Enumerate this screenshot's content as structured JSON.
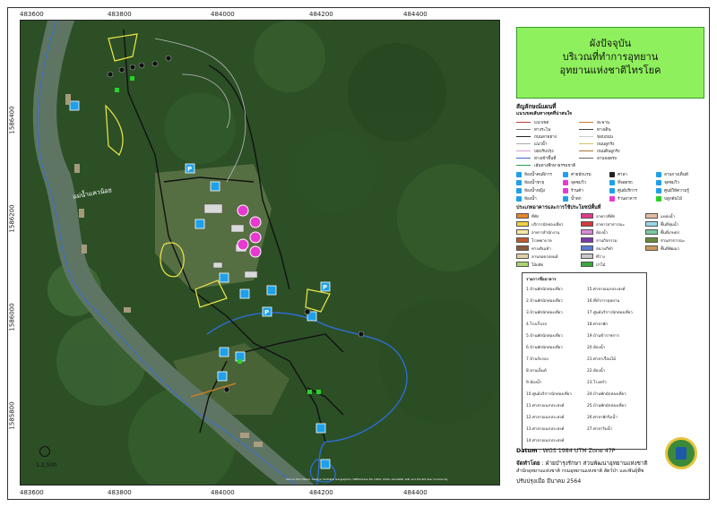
{
  "title": {
    "line1": "ผังปัจจุบัน",
    "line2": "บริเวณที่ทำการอุทยาน",
    "line3": "อุทยานแห่งชาติไทรโยค"
  },
  "grid": {
    "x_ticks": [
      "483600",
      "483800",
      "484000",
      "484200",
      "484400"
    ],
    "y_ticks": [
      "1586400",
      "1586200",
      "1586000",
      "1585800"
    ]
  },
  "legend": {
    "heading": "สัญลักษณ์แผนที่",
    "subheading": "แนวเขตเส้นทางจุดที่น่าสนใจ",
    "lines": [
      {
        "label": "แนวเขต",
        "color": "#c23a3a"
      },
      {
        "label": "ทางระไน",
        "color": "#777777"
      },
      {
        "label": "ถนนลาดยาง",
        "color": "#222222"
      },
      {
        "label": "แนวน้ำ",
        "color": "#aaaaaa"
      },
      {
        "label": "บ่อปรับปรุง",
        "color": "#d4a0d4"
      },
      {
        "label": "ทางเข้าพื้นที่",
        "color": "#3a68c8"
      },
      {
        "label": "เส้นทางศึกษาธรรมชาติ",
        "color": "#2d9e4b"
      },
      {
        "label": "สะพาน",
        "color": "#c77d2a"
      },
      {
        "label": "ทางเดิน",
        "color": "#444444"
      },
      {
        "label": "ขอบถนน",
        "color": "#cccccc"
      },
      {
        "label": "ถนนลูกรัง",
        "color": "#d8c060"
      },
      {
        "label": "ถนนดินลูกรัง",
        "color": "#aa7733"
      },
      {
        "label": "ลานจอดรถ",
        "color": "#666666"
      }
    ],
    "points": [
      {
        "label": "ห้องน้ำคนพิการ",
        "icon": "wheelchair-icon"
      },
      {
        "label": "ห้องน้ำชาย",
        "icon": "male-icon"
      },
      {
        "label": "ห้องน้ำหญิง",
        "icon": "female-icon"
      },
      {
        "label": "ห้องน้ำ",
        "icon": "restroom-icon"
      },
      {
        "label": "ค่ายพักแรม",
        "icon": "camp-icon"
      },
      {
        "label": "จุดชมวิว",
        "icon": "view-icon"
      },
      {
        "label": "ร้านค้า",
        "icon": "shop-icon"
      },
      {
        "label": "น้ำตก",
        "icon": "waterfall-icon"
      },
      {
        "label": "ศาลา",
        "icon": "pavilion-icon"
      },
      {
        "label": "ที่จอดรถ",
        "icon": "parking-icon"
      },
      {
        "label": "ศูนย์บริการ",
        "icon": "info-icon"
      },
      {
        "label": "ร้านอาหาร",
        "icon": "food-icon"
      },
      {
        "label": "ลานกางเต็นท์",
        "icon": "tent-icon"
      },
      {
        "label": "จุดชมวิว",
        "icon": "binocular-icon"
      },
      {
        "label": "ศูนย์ให้ความรู้",
        "icon": "education-icon"
      },
      {
        "label": "ปลูกต้นไม้",
        "icon": "tree-icon"
      }
    ],
    "landuse_heading": "ประเภทอาคารและการใช้ประโยชน์พื้นที่",
    "landuse": [
      {
        "label": "ที่พัก",
        "color": "#e8862a"
      },
      {
        "label": "บริการนักท่องเที่ยว",
        "color": "#f2d23c"
      },
      {
        "label": "อาคารสำนักงาน",
        "color": "#f5e6a6"
      },
      {
        "label": "โรงพยาบาล",
        "color": "#c05a2e"
      },
      {
        "label": "ทางเดินเท้า",
        "color": "#8a5a3a"
      },
      {
        "label": "ลานจอดรถยนต์",
        "color": "#e3cfa7"
      },
      {
        "label": "ไม้ผลัด",
        "color": "#a8d46a"
      },
      {
        "label": "อาคารที่พัก",
        "color": "#e23a8a"
      },
      {
        "label": "อาคารสาธารณะ",
        "color": "#d43a3a"
      },
      {
        "label": "ห้องน้ำ",
        "color": "#d78ad7"
      },
      {
        "label": "ลานกิจกรรม",
        "color": "#7a3aa8"
      },
      {
        "label": "สนามกีฬา",
        "color": "#5a7ad8"
      },
      {
        "label": "ที่ว่าง",
        "color": "#c8c8c8"
      },
      {
        "label": "ป่าไม้",
        "color": "#3aa83a"
      },
      {
        "label": "แหล่งน้ำ",
        "color": "#e2bca0"
      },
      {
        "label": "พื้นที่ชุ่มน้ำ",
        "color": "#9ad6e8"
      },
      {
        "label": "พื้นที่เกษตร",
        "color": "#78c8a0"
      },
      {
        "label": "สวนสาธารณะ",
        "color": "#6a8a3a"
      },
      {
        "label": "พื้นที่พัฒนา",
        "color": "#c89a5a"
      }
    ]
  },
  "place_list": {
    "heading": "รายการชื่ออาคาร",
    "col1": [
      "1.บ้านพักนักท่องเที่ยว",
      "2.บ้านพักนักท่องเที่ยว",
      "3.บ้านพักนักท่องเที่ยว",
      "4.โรงเก็บรถ",
      "5.บ้านพักนักท่องเที่ยว",
      "6.บ้านพักนักท่องเที่ยว",
      "7.บ้านรับรอง",
      "8.ลานเต็นท์",
      "9.ห้องน้ำ",
      "10.ศูนย์บริการนักท่องเที่ยว",
      "11.ศาลาอเนกประสงค์",
      "12.ศาลาอเนกประสงค์",
      "13.ศาลาอเนกประสงค์",
      "14.ศาลาอเนกประสงค์"
    ],
    "col2": [
      "15.ศาลาอเนกประสงค์",
      "16.ที่ทำการอุทยาน",
      "17.ศูนย์บริการนักท่องเที่ยว",
      "18.ศาลาพัก",
      "19.บ้านข้าราชการ",
      "20.ห้องน้ำ",
      "21.ศาลาเรือนไม้",
      "22.ห้องน้ำ",
      "23.โรงครัว",
      "24.บ้านพักนักท่องเที่ยว",
      "25.บ้านพักนักท่องเที่ยว",
      "26.ศาลาพักริมน้ำ",
      "27.ศาลาริมน้ำ"
    ]
  },
  "meta": {
    "datum_label": "Datum",
    "datum": "WGS 1984 UTM Zone 47P",
    "author_label": "จัดทำโดย",
    "author": "ฝ่ายบำรุงรักษา ส่วนพัฒนาอุทยานแห่งชาติ",
    "org": "สำนักอุทยานแห่งชาติ กรมอุทยานแห่งชาติ สัตว์ป่า และพันธุ์พืช",
    "date_label": "ปรับปรุงเมื่อ",
    "date": "มีนาคม 2564"
  },
  "scale": {
    "text": "1:2,500"
  },
  "credits": "Source: Esri, Maxar, GeoEye, Earthstar Geographics, CNES/Airbus DS, USDA, USGS, AeroGRID, IGN, and the GIS User Community",
  "river_label": "แม่น้ำแควน้อย"
}
